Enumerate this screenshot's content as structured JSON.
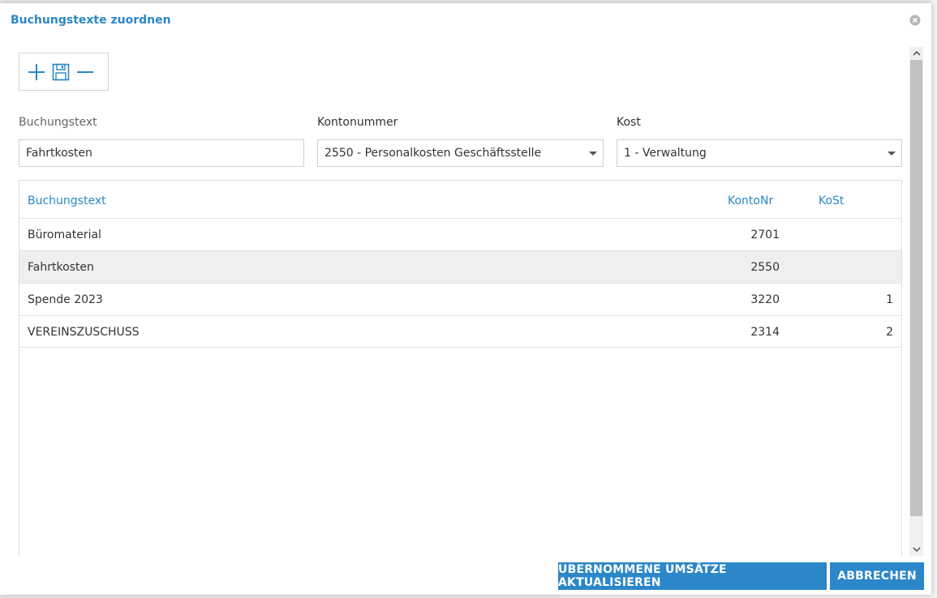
{
  "dialog": {
    "title": "Buchungstexte zuordnen"
  },
  "toolbar": {
    "icons": [
      "plus-icon",
      "save-icon",
      "minus-icon"
    ]
  },
  "form": {
    "buchungstext_label": "Buchungstext",
    "buchungstext_value": "Fahrtkosten",
    "kontonummer_label": "Kontonummer",
    "kontonummer_value": "2550 - Personalkosten Geschäftsstelle",
    "kost_label": "Kost",
    "kost_value": "1 - Verwaltung"
  },
  "table": {
    "headers": {
      "buchungstext": "Buchungstext",
      "kontonr": "KontoNr",
      "kost": "KoSt"
    },
    "rows": [
      {
        "buchungstext": "Büromaterial",
        "kontonr": "2701",
        "kost": ""
      },
      {
        "buchungstext": "Fahrtkosten",
        "kontonr": "2550",
        "kost": ""
      },
      {
        "buchungstext": "Spende 2023",
        "kontonr": "3220",
        "kost": "1"
      },
      {
        "buchungstext": "VEREINSZUSCHUSS",
        "kontonr": "2314",
        "kost": "2"
      }
    ]
  },
  "buttons": {
    "update": "UBERNOMMENE UMSÄTZE AKTUALISIEREN",
    "cancel": "ABBRECHEN"
  },
  "colors": {
    "accent": "#2b87c8",
    "selected_row": "#efefef"
  }
}
